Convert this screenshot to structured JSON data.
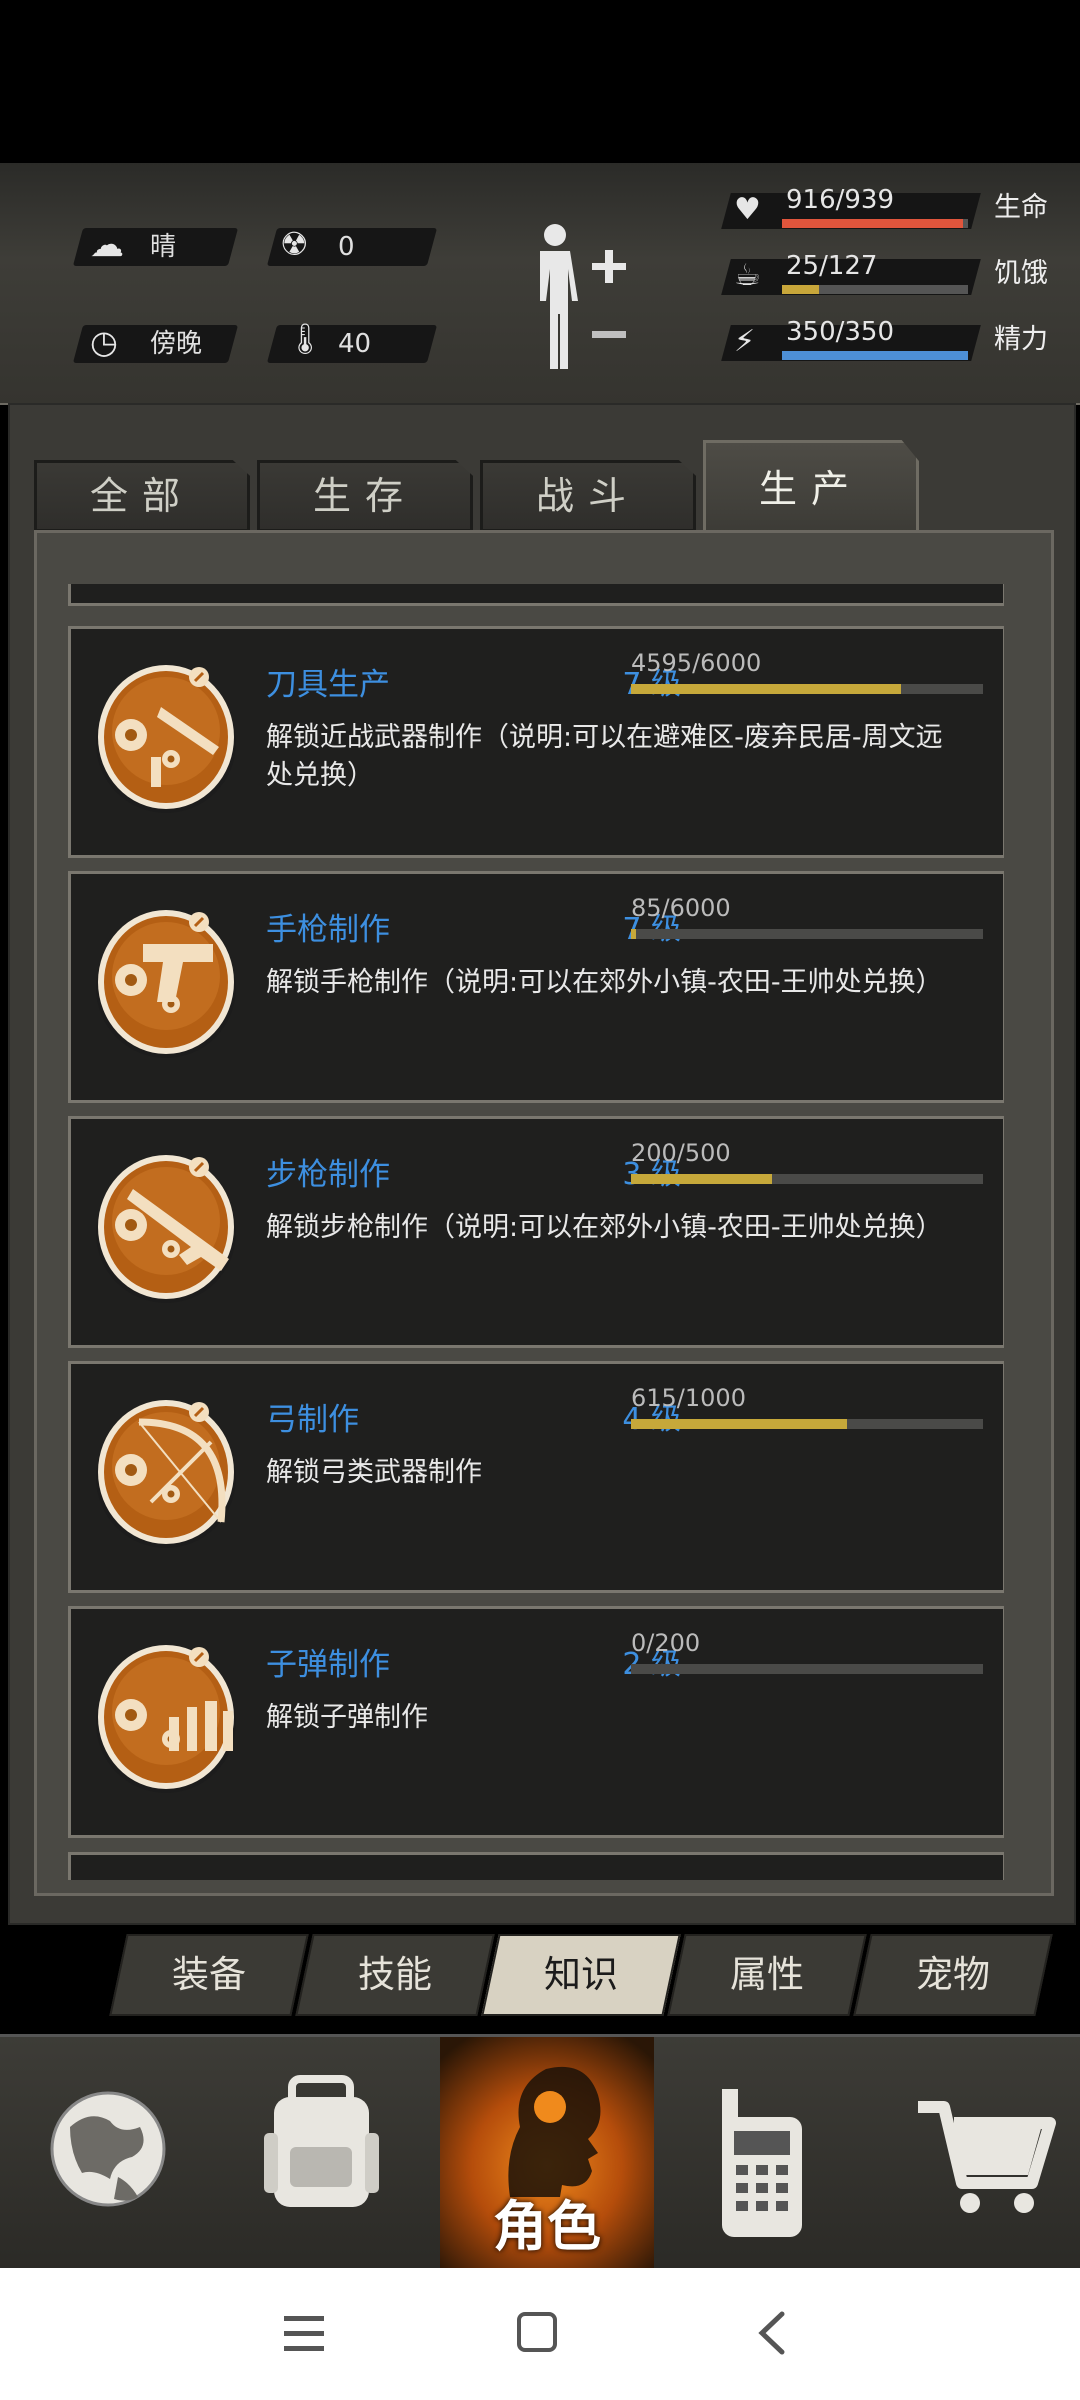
{
  "hud": {
    "weather": "晴",
    "radiation": "0",
    "time_of_day": "傍晚",
    "temperature": "40",
    "stats": [
      {
        "value": "916/939",
        "label": "生命",
        "fraction": 0.975,
        "color": "#e0553c"
      },
      {
        "value": "25/127",
        "label": "饥饿",
        "fraction": 0.197,
        "color": "#c8a63a"
      },
      {
        "value": "350/350",
        "label": "精力",
        "fraction": 1.0,
        "color": "#4d8fd6"
      }
    ]
  },
  "tabs": [
    {
      "label": "全部",
      "active": false
    },
    {
      "label": "生存",
      "active": false
    },
    {
      "label": "战斗",
      "active": false
    },
    {
      "label": "生产",
      "active": true
    }
  ],
  "knowledge": [
    {
      "name": "刀具生产",
      "level": "7 级",
      "progress": "4595/6000",
      "fraction": 0.766,
      "desc": "解锁近战武器制作（说明:可以在避难区-废弃民居-周文远处兑换）",
      "icon": "knife-icon"
    },
    {
      "name": "手枪制作",
      "level": "7 级",
      "progress": "85/6000",
      "fraction": 0.014,
      "desc": "解锁手枪制作（说明:可以在郊外小镇-农田-王帅处兑换）",
      "icon": "pistol-icon"
    },
    {
      "name": "步枪制作",
      "level": "3 级",
      "progress": "200/500",
      "fraction": 0.4,
      "desc": "解锁步枪制作（说明:可以在郊外小镇-农田-王帅处兑换）",
      "icon": "rifle-icon"
    },
    {
      "name": "弓制作",
      "level": "4 级",
      "progress": "615/1000",
      "fraction": 0.615,
      "desc": "解锁弓类武器制作",
      "icon": "bow-icon"
    },
    {
      "name": "子弹制作",
      "level": "2 级",
      "progress": "0/200",
      "fraction": 0.0,
      "desc": "解锁子弹制作",
      "icon": "bullets-icon"
    }
  ],
  "subtabs": [
    {
      "label": "装备",
      "active": false
    },
    {
      "label": "技能",
      "active": false
    },
    {
      "label": "知识",
      "active": true
    },
    {
      "label": "属性",
      "active": false
    },
    {
      "label": "宠物",
      "active": false
    }
  ],
  "bottom_nav": {
    "active_label": "角色",
    "items": [
      "globe-icon",
      "backpack-icon",
      "character-icon",
      "radio-icon",
      "cart-icon"
    ]
  },
  "colors": {
    "accent": "#3d8fe0",
    "progress": "#c6a83a",
    "active_orange": "#f08a1c"
  }
}
